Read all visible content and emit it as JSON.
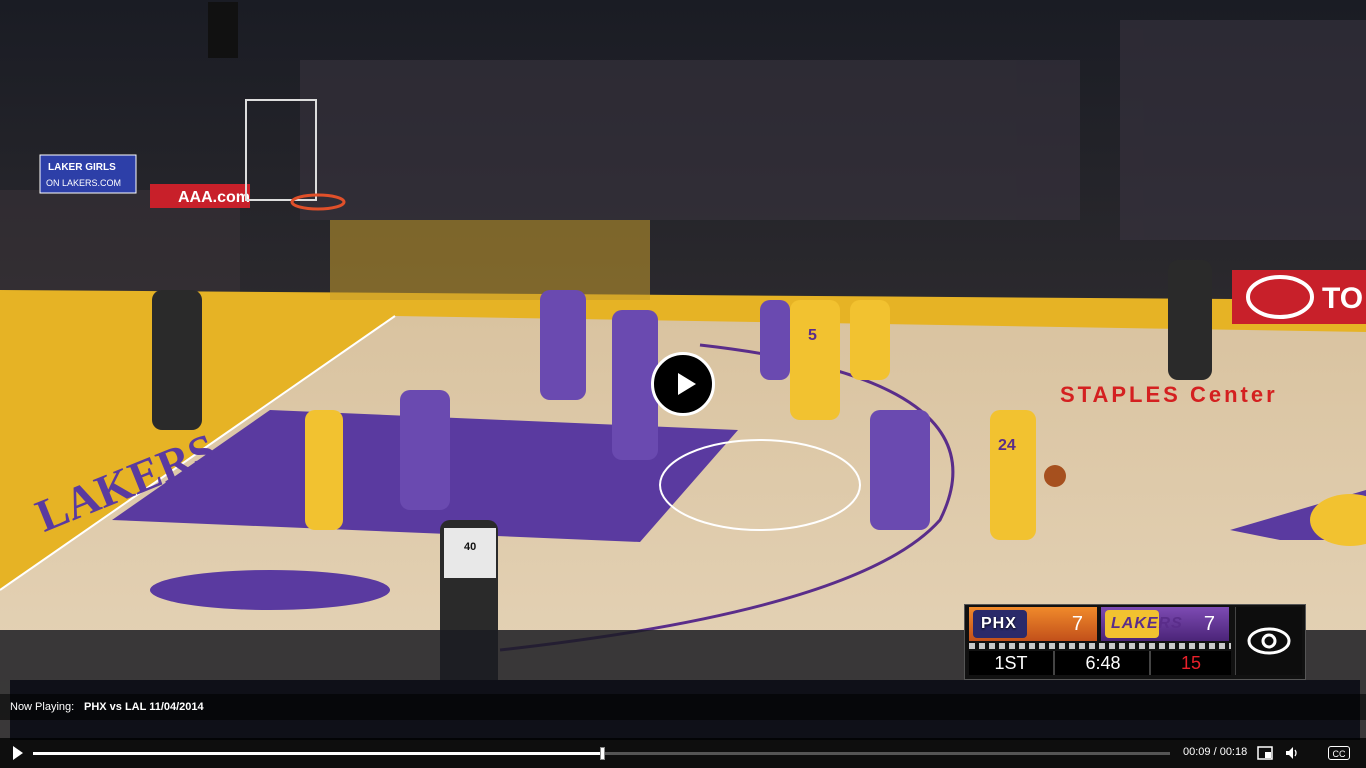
{
  "video": {
    "now_playing_label": "Now Playing:",
    "now_playing_title": "PHX vs LAL 11/04/2014",
    "current_time": "00:09",
    "duration": "00:18",
    "time_display": "00:09 / 00:18",
    "progress": 0.5,
    "play_icon": "play-icon",
    "cc_label": "CC"
  },
  "scoreboard": {
    "home": {
      "abbr": "PHX",
      "score": "7",
      "color": "#e8782a"
    },
    "away": {
      "abbr": "LAKERS",
      "score": "7",
      "color": "#5a2d8a"
    },
    "period": "1ST",
    "clock": "6:48",
    "shot_clock": "15"
  },
  "arena": {
    "banner_laker_girls": "LAKER GIRLS ON LAKERS.COM",
    "banner_aaa": "AAA.com",
    "court_text_lakers": "LAKERS",
    "court_text_staples": "STAPLES Center",
    "sponsor": "TO",
    "player_numbers": [
      "5",
      "24",
      "40"
    ]
  }
}
